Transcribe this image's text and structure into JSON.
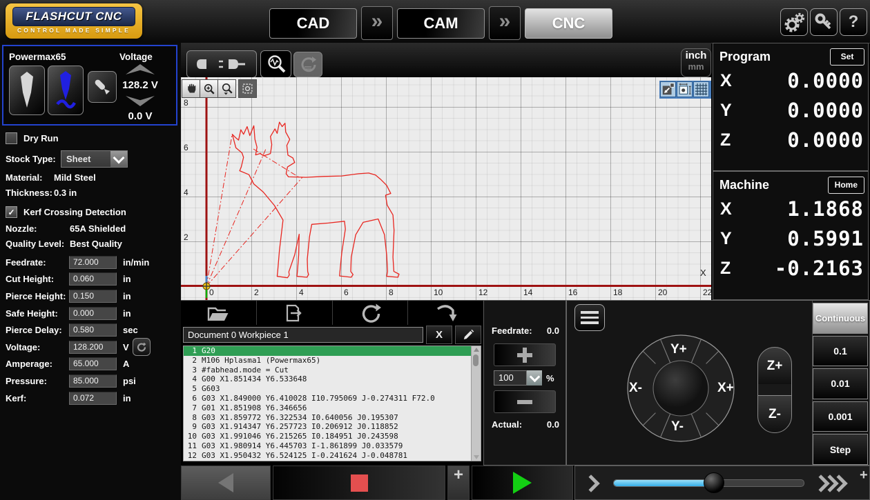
{
  "topbar": {
    "logo_title": "FLASHCUT CNC",
    "logo_subtitle": "CONTROL MADE SIMPLE",
    "nav": [
      {
        "label": "CAD",
        "active": false
      },
      {
        "label": "CAM",
        "active": false
      },
      {
        "label": "CNC",
        "active": true
      }
    ],
    "nav_separator": "»",
    "help_label": "?"
  },
  "torch": {
    "title": "Powermax65",
    "voltage_label": "Voltage",
    "voltage_current": "128.2  V",
    "voltage_set": "0.0 V"
  },
  "options": {
    "dry_run_label": "Dry Run",
    "stock_type_label": "Stock Type:",
    "stock_type_value": "Sheet",
    "material_label": "Material:",
    "material_value": "Mild Steel",
    "thickness_label": "Thickness:",
    "thickness_value": "0.3 in",
    "kerf_crossing_label": "Kerf Crossing Detection",
    "kerf_crossing_checked": "✓",
    "nozzle_label": "Nozzle:",
    "nozzle_value": "65A Shielded",
    "quality_label": "Quality Level:",
    "quality_value": "Best Quality",
    "fields": [
      {
        "label": "Feedrate:",
        "value": "72.000",
        "unit": "in/min"
      },
      {
        "label": "Cut Height:",
        "value": "0.060",
        "unit": "in"
      },
      {
        "label": "Pierce Height:",
        "value": "0.150",
        "unit": "in"
      },
      {
        "label": "Safe Height:",
        "value": "0.000",
        "unit": "in"
      },
      {
        "label": "Pierce Delay:",
        "value": "0.580",
        "unit": "sec"
      },
      {
        "label": "Voltage:",
        "value": "128.200",
        "unit": "V",
        "refresh": true
      },
      {
        "label": "Amperage:",
        "value": "65.000",
        "unit": "A"
      },
      {
        "label": "Pressure:",
        "value": "85.000",
        "unit": "psi"
      },
      {
        "label": "Kerf:",
        "value": "0.072",
        "unit": "in"
      }
    ]
  },
  "viewport": {
    "units_primary": "inch",
    "units_secondary": "mm",
    "x_axis_label": "X",
    "x_ticks": [
      {
        "v": "0"
      },
      {
        "v": "2"
      },
      {
        "v": "4"
      },
      {
        "v": "6"
      },
      {
        "v": "8"
      },
      {
        "v": "10"
      },
      {
        "v": "12"
      },
      {
        "v": "14"
      },
      {
        "v": "16"
      },
      {
        "v": "18"
      },
      {
        "v": "20"
      },
      {
        "v": "22"
      }
    ],
    "y_ticks": [
      {
        "v": "8"
      },
      {
        "v": "6"
      },
      {
        "v": "4"
      },
      {
        "v": "2"
      }
    ]
  },
  "dro": {
    "program": {
      "title": "Program",
      "action": "Set",
      "rows": [
        {
          "axis": "X",
          "value": "0.0000"
        },
        {
          "axis": "Y",
          "value": "0.0000"
        },
        {
          "axis": "Z",
          "value": "0.0000"
        }
      ]
    },
    "machine": {
      "title": "Machine",
      "action": "Home",
      "rows": [
        {
          "axis": "X",
          "value": "1.1868"
        },
        {
          "axis": "Y",
          "value": "0.5991"
        },
        {
          "axis": "Z",
          "value": "-0.2163"
        }
      ]
    }
  },
  "gcode": {
    "document_tab": "Document 0 Workpiece 1",
    "close_glyph": "X",
    "lines": [
      {
        "n": "1",
        "text": "G20",
        "hl": true
      },
      {
        "n": "2",
        "text": "M106 Hplasma1 (Powermax65)"
      },
      {
        "n": "3",
        "text": "#fabhead.mode = Cut"
      },
      {
        "n": "4",
        "text": "G00 X1.851434 Y6.533648"
      },
      {
        "n": "5",
        "text": "G603"
      },
      {
        "n": "6",
        "text": "G03 X1.849000 Y6.410028 I10.795069 J-0.274311 F72.0"
      },
      {
        "n": "7",
        "text": "G01 X1.851908 Y6.346656"
      },
      {
        "n": "8",
        "text": "G03 X1.859772 Y6.322534 I0.640056 J0.195307"
      },
      {
        "n": "9",
        "text": "G03 X1.914347 Y6.257723 I0.206912 J0.118852"
      },
      {
        "n": "10",
        "text": "G03 X1.991046 Y6.215265 I0.184951 J0.243598"
      },
      {
        "n": "11",
        "text": "G03 X1.980914 Y6.445703 I-1.861899 J0.033579"
      },
      {
        "n": "12",
        "text": "G03 X1.950432 Y6.524125 I-0.241624 J-0.048781"
      }
    ]
  },
  "feed_panel": {
    "feedrate_label": "Feedrate:",
    "feedrate_value": "0.0",
    "override_value": "100",
    "percent": "%",
    "actual_label": "Actual:",
    "actual_value": "0.0"
  },
  "jog": {
    "y_plus": "Y+",
    "y_minus": "Y-",
    "x_plus": "X+",
    "x_minus": "X-",
    "z_plus": "Z+",
    "z_minus": "Z-",
    "modes": [
      {
        "label": "Continuous",
        "active": true
      },
      {
        "label": "0.1"
      },
      {
        "label": "0.01"
      },
      {
        "label": "0.001"
      },
      {
        "label": "Step"
      }
    ]
  },
  "transport": {
    "expand_glyph": "+"
  },
  "colors": {
    "accent_blue_border": "#2343cf",
    "toolpath_red": "#e8251f",
    "axis_red": "#9e1212",
    "gcode_highlight_green": "#2f9e54",
    "play_green": "#13cf13",
    "stop_red": "#e44f4f",
    "slider_blue": "#35aee8",
    "logo_gold": "#e9a91c",
    "logo_navy": "#2a3d6e",
    "corner_button_blue": "#aecbe3"
  }
}
